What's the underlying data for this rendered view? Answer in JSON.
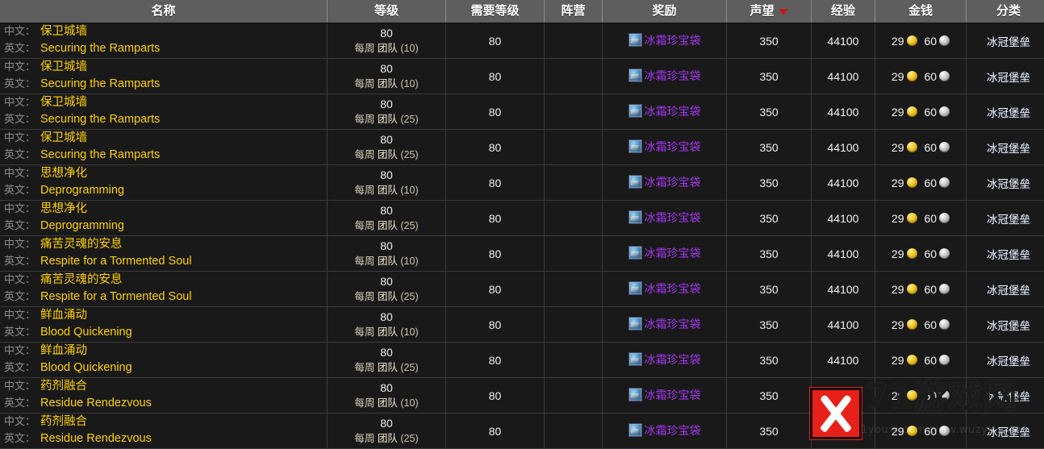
{
  "table": {
    "columns": [
      {
        "key": "name",
        "label": "名称",
        "sorted": false
      },
      {
        "key": "level",
        "label": "等级",
        "sorted": false
      },
      {
        "key": "req_level",
        "label": "需要等级",
        "sorted": false
      },
      {
        "key": "faction",
        "label": "阵营",
        "sorted": false
      },
      {
        "key": "reward",
        "label": "奖励",
        "sorted": false
      },
      {
        "key": "reputation",
        "label": "声望",
        "sorted": true
      },
      {
        "key": "exp",
        "label": "经验",
        "sorted": false
      },
      {
        "key": "money",
        "label": "金钱",
        "sorted": false
      },
      {
        "key": "category",
        "label": "分类",
        "sorted": false
      }
    ],
    "labels": {
      "cn_prefix": "中文：",
      "en_prefix": "英文：",
      "sort_icon": "sort-descending-icon"
    },
    "rows": [
      {
        "cn": "保卫城墙",
        "en": "Securing the Ramparts",
        "level": "80",
        "period": "每周",
        "type": "团队",
        "size": "(10)",
        "req_level": "80",
        "faction": "",
        "reward_icon": "frost-satchel-icon",
        "reward": "冰霜珍宝袋",
        "reputation": "350",
        "exp": "44100",
        "gold": "29",
        "silver": "60",
        "category": "冰冠堡垒"
      },
      {
        "cn": "保卫城墙",
        "en": "Securing the Ramparts",
        "level": "80",
        "period": "每周",
        "type": "团队",
        "size": "(10)",
        "req_level": "80",
        "faction": "",
        "reward_icon": "frost-satchel-icon",
        "reward": "冰霜珍宝袋",
        "reputation": "350",
        "exp": "44100",
        "gold": "29",
        "silver": "60",
        "category": "冰冠堡垒"
      },
      {
        "cn": "保卫城墙",
        "en": "Securing the Ramparts",
        "level": "80",
        "period": "每周",
        "type": "团队",
        "size": "(25)",
        "req_level": "80",
        "faction": "",
        "reward_icon": "frost-satchel-icon",
        "reward": "冰霜珍宝袋",
        "reputation": "350",
        "exp": "44100",
        "gold": "29",
        "silver": "60",
        "category": "冰冠堡垒"
      },
      {
        "cn": "保卫城墙",
        "en": "Securing the Ramparts",
        "level": "80",
        "period": "每周",
        "type": "团队",
        "size": "(25)",
        "req_level": "80",
        "faction": "",
        "reward_icon": "frost-satchel-icon",
        "reward": "冰霜珍宝袋",
        "reputation": "350",
        "exp": "44100",
        "gold": "29",
        "silver": "60",
        "category": "冰冠堡垒"
      },
      {
        "cn": "思想净化",
        "en": "Deprogramming",
        "level": "80",
        "period": "每周",
        "type": "团队",
        "size": "(10)",
        "req_level": "80",
        "faction": "",
        "reward_icon": "frost-satchel-icon",
        "reward": "冰霜珍宝袋",
        "reputation": "350",
        "exp": "44100",
        "gold": "29",
        "silver": "60",
        "category": "冰冠堡垒"
      },
      {
        "cn": "思想净化",
        "en": "Deprogramming",
        "level": "80",
        "period": "每周",
        "type": "团队",
        "size": "(25)",
        "req_level": "80",
        "faction": "",
        "reward_icon": "frost-satchel-icon",
        "reward": "冰霜珍宝袋",
        "reputation": "350",
        "exp": "44100",
        "gold": "29",
        "silver": "60",
        "category": "冰冠堡垒"
      },
      {
        "cn": "痛苦灵魂的安息",
        "en": "Respite for a Tormented Soul",
        "level": "80",
        "period": "每周",
        "type": "团队",
        "size": "(10)",
        "req_level": "80",
        "faction": "",
        "reward_icon": "frost-satchel-icon",
        "reward": "冰霜珍宝袋",
        "reputation": "350",
        "exp": "44100",
        "gold": "29",
        "silver": "60",
        "category": "冰冠堡垒"
      },
      {
        "cn": "痛苦灵魂的安息",
        "en": "Respite for a Tormented Soul",
        "level": "80",
        "period": "每周",
        "type": "团队",
        "size": "(25)",
        "req_level": "80",
        "faction": "",
        "reward_icon": "frost-satchel-icon",
        "reward": "冰霜珍宝袋",
        "reputation": "350",
        "exp": "44100",
        "gold": "29",
        "silver": "60",
        "category": "冰冠堡垒"
      },
      {
        "cn": "鲜血涌动",
        "en": "Blood Quickening",
        "level": "80",
        "period": "每周",
        "type": "团队",
        "size": "(10)",
        "req_level": "80",
        "faction": "",
        "reward_icon": "frost-satchel-icon",
        "reward": "冰霜珍宝袋",
        "reputation": "350",
        "exp": "44100",
        "gold": "29",
        "silver": "60",
        "category": "冰冠堡垒"
      },
      {
        "cn": "鲜血涌动",
        "en": "Blood Quickening",
        "level": "80",
        "period": "每周",
        "type": "团队",
        "size": "(25)",
        "req_level": "80",
        "faction": "",
        "reward_icon": "frost-satchel-icon",
        "reward": "冰霜珍宝袋",
        "reputation": "350",
        "exp": "44100",
        "gold": "29",
        "silver": "60",
        "category": "冰冠堡垒"
      },
      {
        "cn": "药剂融合",
        "en": "Residue Rendezvous",
        "level": "80",
        "period": "每周",
        "type": "团队",
        "size": "(10)",
        "req_level": "80",
        "faction": "",
        "reward_icon": "frost-satchel-icon",
        "reward": "冰霜珍宝袋",
        "reputation": "350",
        "exp": "44100",
        "gold": "29",
        "silver": "60",
        "category": "冰冠堡垒"
      },
      {
        "cn": "药剂融合",
        "en": "Residue Rendezvous",
        "level": "80",
        "period": "每周",
        "type": "团队",
        "size": "(25)",
        "req_level": "80",
        "faction": "",
        "reward_icon": "frost-satchel-icon",
        "reward": "冰霜珍宝袋",
        "reputation": "350",
        "exp": "44100",
        "gold": "29",
        "silver": "60",
        "category": "冰冠堡垒"
      }
    ]
  },
  "watermark": {
    "site_name": "71游戏网",
    "url": "www.71youxi.com   www.wuzyx.com",
    "logo_icon": "g-swirl-logo-icon",
    "overlay_icon": "red-x-stamp-icon"
  },
  "colors": {
    "header_bg": "#5e5e5e",
    "row_bg": "#191919",
    "quest_link": "#ffd100",
    "item_epic": "#a335ee",
    "sort_arrow": "#c01a1a",
    "gold_coin": "#f0c425",
    "silver_coin": "#c9c9c9"
  }
}
